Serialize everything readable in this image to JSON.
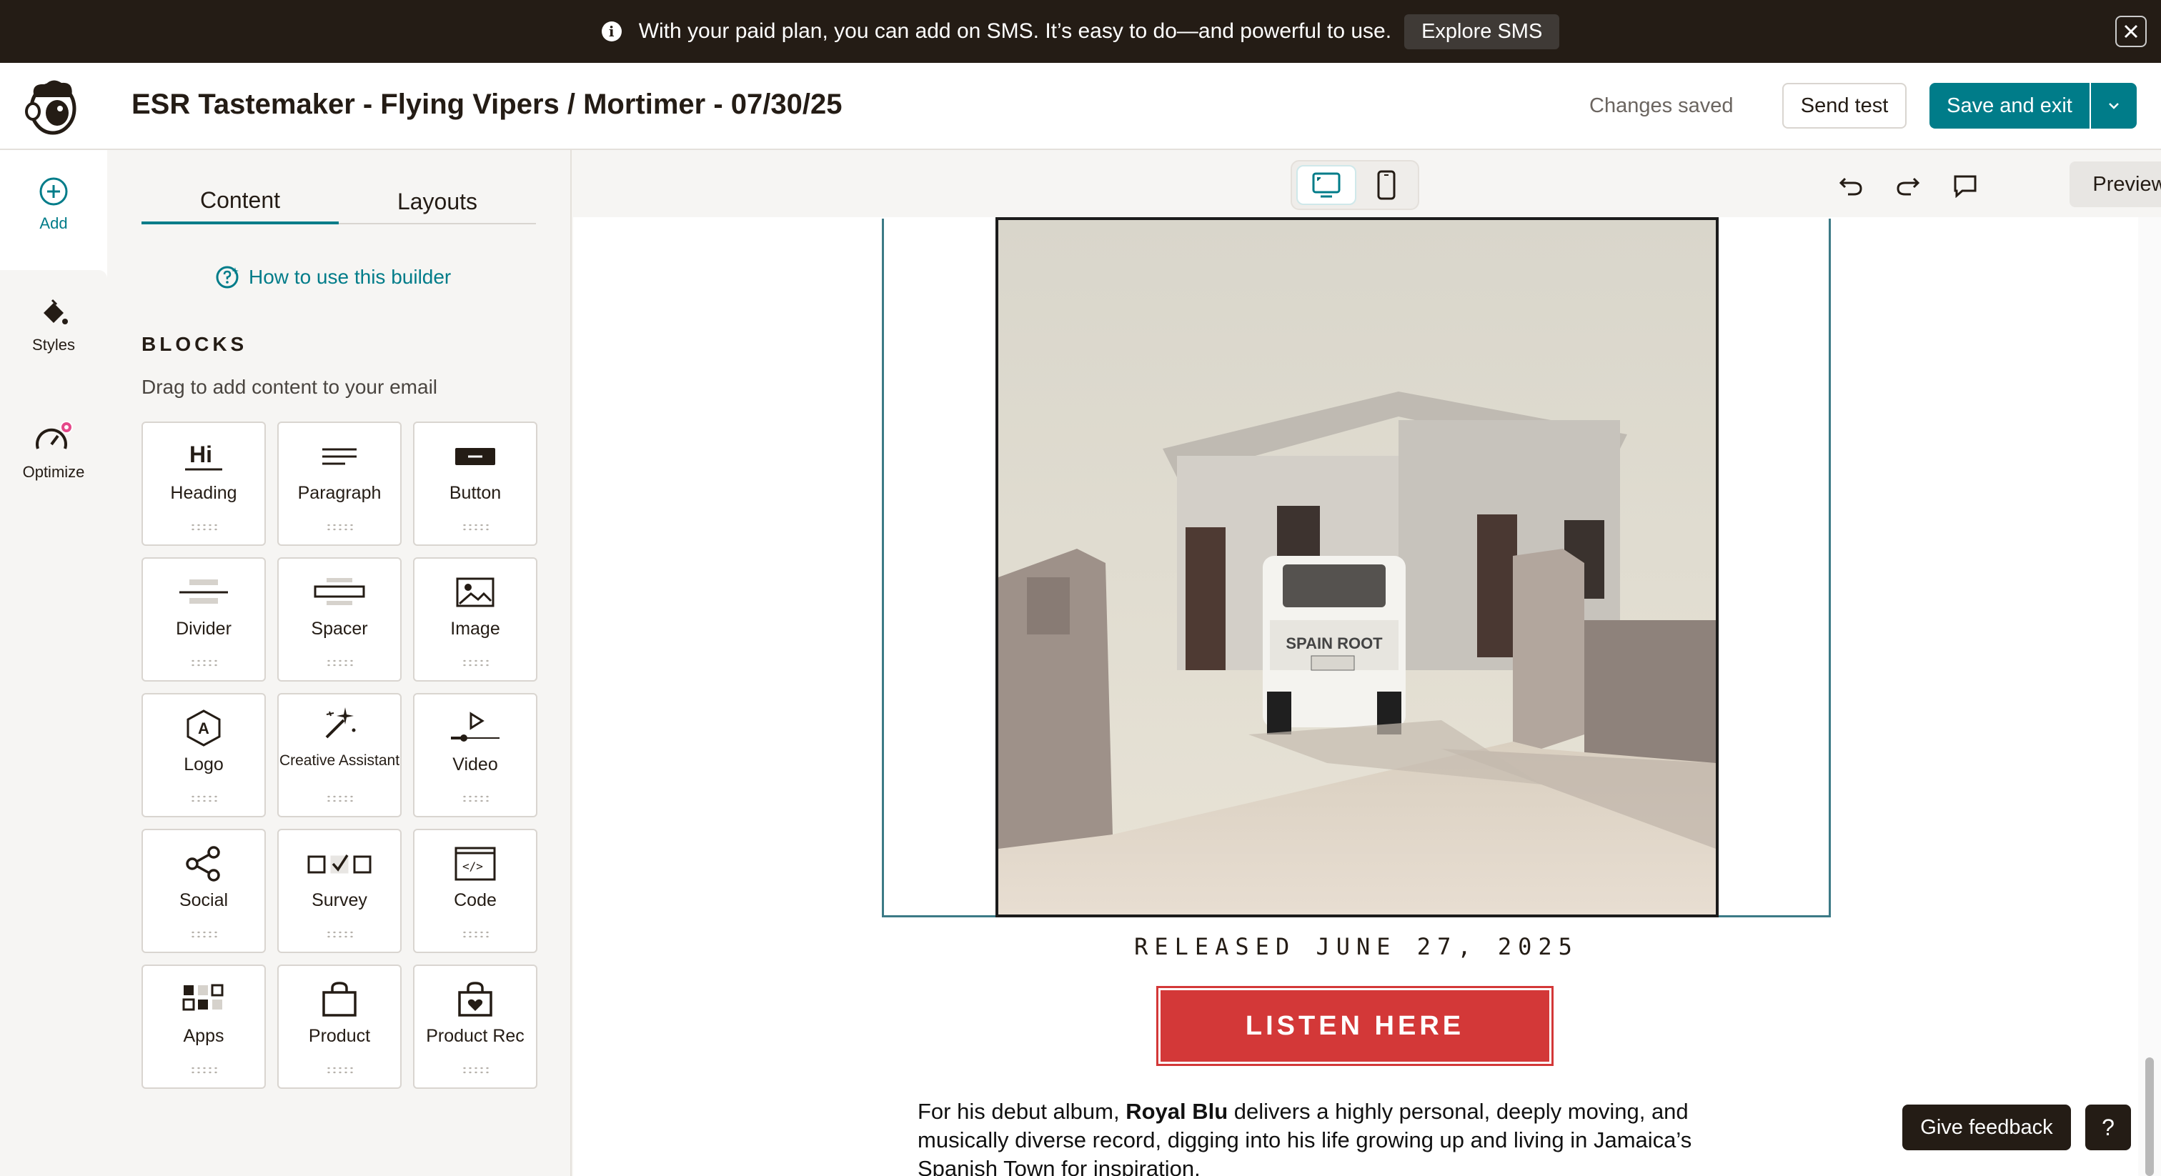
{
  "banner": {
    "message": "With your paid plan, you can add on SMS. It’s easy to do—and powerful to use.",
    "cta_label": "Explore SMS"
  },
  "header": {
    "title": "ESR Tastemaker - Flying Vipers / Mortimer - 07/30/25",
    "status": "Changes saved",
    "send_test_label": "Send test",
    "save_exit_label": "Save and exit"
  },
  "rail": {
    "add_label": "Add",
    "styles_label": "Styles",
    "optimize_label": "Optimize"
  },
  "panel": {
    "tabs": {
      "content": "Content",
      "layouts": "Layouts"
    },
    "help_link": "How to use this builder",
    "blocks_title": "BLOCKS",
    "blocks_subtitle": "Drag to add content to your email",
    "blocks": [
      {
        "label": "Heading",
        "icon": "heading-icon"
      },
      {
        "label": "Paragraph",
        "icon": "paragraph-icon"
      },
      {
        "label": "Button",
        "icon": "button-icon"
      },
      {
        "label": "Divider",
        "icon": "divider-icon"
      },
      {
        "label": "Spacer",
        "icon": "spacer-icon"
      },
      {
        "label": "Image",
        "icon": "image-icon"
      },
      {
        "label": "Logo",
        "icon": "logo-icon"
      },
      {
        "label": "Creative Assistant",
        "icon": "magic-wand-icon"
      },
      {
        "label": "Video",
        "icon": "video-icon"
      },
      {
        "label": "Social",
        "icon": "share-icon"
      },
      {
        "label": "Survey",
        "icon": "survey-icon"
      },
      {
        "label": "Code",
        "icon": "code-icon"
      },
      {
        "label": "Apps",
        "icon": "apps-icon"
      },
      {
        "label": "Product",
        "icon": "shopping-bag-icon"
      },
      {
        "label": "Product Rec",
        "icon": "product-rec-icon"
      }
    ],
    "heading_icon_text": "Hi",
    "logo_icon_text": "A",
    "code_icon_text": "</>"
  },
  "canvas": {
    "preview_label": "Preview",
    "truck_text": "SPAIN ROOT",
    "released_text": "RELEASED JUNE 27, 2025",
    "listen_button": "LISTEN HERE",
    "body_prefix": "For his debut album, ",
    "body_bold": "Royal Blu",
    "body_rest": " delivers a highly personal, deeply moving, and musically diverse record, digging into his life growing up and living in Jamaica’s Spanish Town for inspiration."
  },
  "footer": {
    "feedback_label": "Give feedback",
    "help_label": "?"
  },
  "colors": {
    "accent": "#007c89",
    "banner_bg": "#241c15",
    "listen_button": "#d33838",
    "optimize_badge": "#e5498a"
  }
}
